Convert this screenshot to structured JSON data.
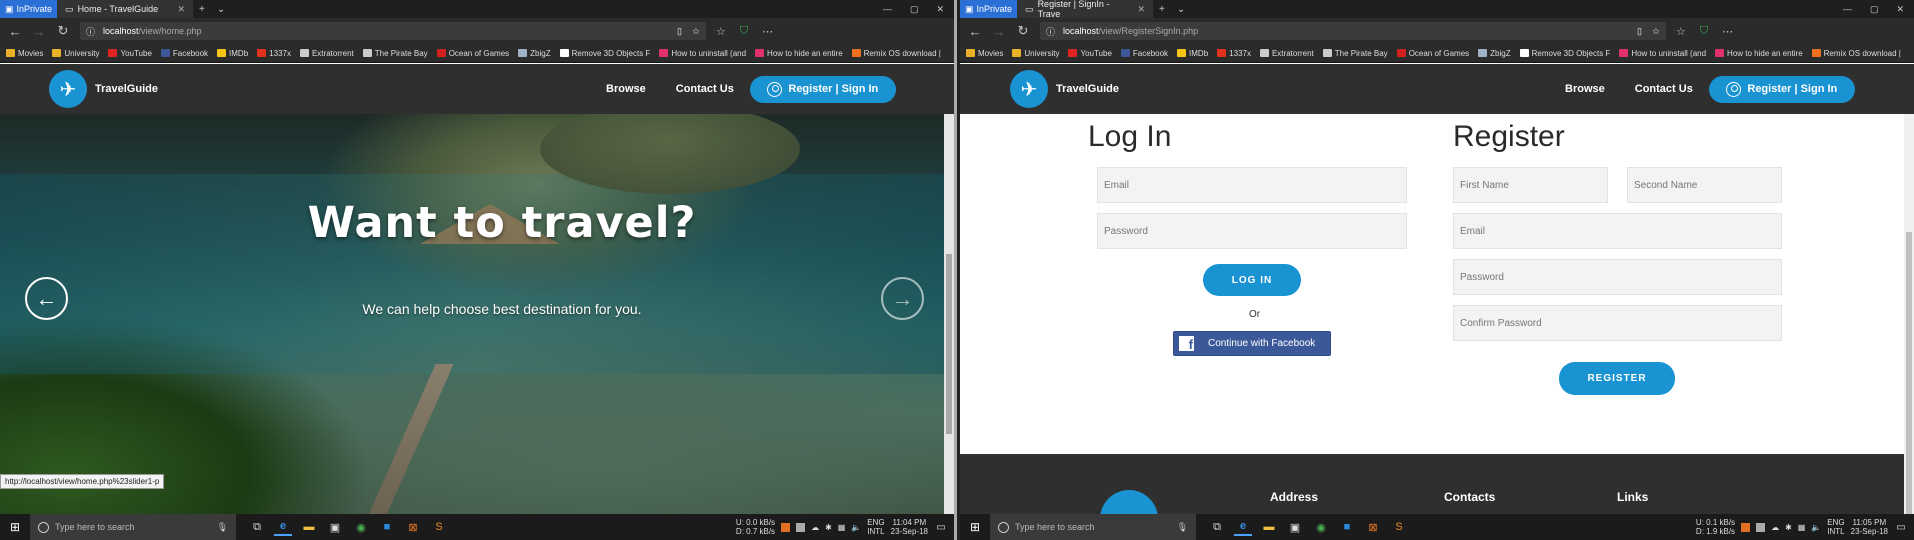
{
  "left": {
    "inprivate": "InPrivate",
    "tab_title": "Home - TravelGuide",
    "url_host": "localhost",
    "url_path": "/view/home.php",
    "hero": {
      "title": "Want to travel?",
      "subtitle": "We can help choose best destination for you."
    },
    "status_url": "http://localhost/view/home.php%23slider1-p",
    "time": "11:04 PM",
    "date": "23-Sep-18",
    "net_up": "0.0 kB/s",
    "net_down": "0.7 kB/s"
  },
  "right": {
    "inprivate": "InPrivate",
    "tab_title": "Register | SignIn - Trave",
    "url_host": "localhost",
    "url_path": "/view/RegisterSignIn.php",
    "login": {
      "heading": "Log In",
      "email_placeholder": "Email",
      "password_placeholder": "Password",
      "button": "LOG IN",
      "or": "Or",
      "facebook": "Continue with Facebook"
    },
    "register": {
      "heading": "Register",
      "first_name_placeholder": "First Name",
      "second_name_placeholder": "Second Name",
      "email_placeholder": "Email",
      "password_placeholder": "Password",
      "confirm_placeholder": "Confirm Password",
      "button": "REGISTER"
    },
    "footer": {
      "address": "Address",
      "contacts": "Contacts",
      "links": "Links"
    },
    "time": "11:05 PM",
    "date": "23-Sep-18",
    "net_up": "0.1 kB/s",
    "net_down": "1.9 kB/s"
  },
  "site": {
    "brand": "TravelGuide",
    "nav_browse": "Browse",
    "nav_contact": "Contact Us",
    "register_signin": "Register | Sign In",
    "brand_color": "#1a93d2"
  },
  "favorites": [
    {
      "label": "Movies",
      "color": "#e8b32a"
    },
    {
      "label": "University",
      "color": "#e8b32a"
    },
    {
      "label": "YouTube",
      "color": "#e02424"
    },
    {
      "label": "Facebook",
      "color": "#3b5998"
    },
    {
      "label": "IMDb",
      "color": "#f5c518"
    },
    {
      "label": "1337x",
      "color": "#e0301e"
    },
    {
      "label": "Extratorrent",
      "color": "#cccccc"
    },
    {
      "label": "The Pirate Bay",
      "color": "#cccccc"
    },
    {
      "label": "Ocean of Games",
      "color": "#d02020"
    },
    {
      "label": "ZbigZ",
      "color": "#9fb3c8"
    },
    {
      "label": "Remove 3D Objects F",
      "color": "#ffffff"
    },
    {
      "label": "How to uninstall (and",
      "color": "#e0306e"
    },
    {
      "label": "How to hide an entire",
      "color": "#e0306e"
    },
    {
      "label": "Remix OS download |",
      "color": "#f07020"
    }
  ],
  "taskbar": {
    "search_placeholder": "Type here to search",
    "lang_top": "ENG",
    "lang_bottom": "INTL",
    "net_up_label": "U:",
    "net_down_label": "D:"
  }
}
